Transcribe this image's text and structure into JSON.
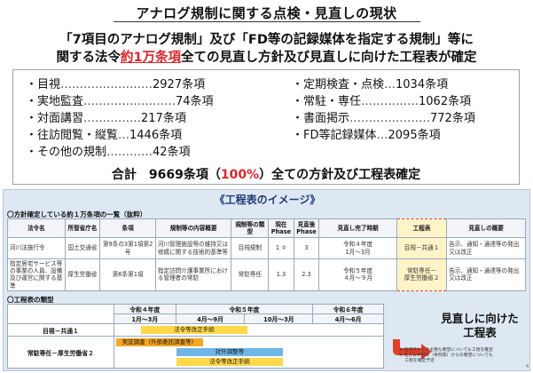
{
  "title": "アナログ規制に関する点検・見直しの現状",
  "lead": {
    "line1": "「7項目のアナログ規制」及び「FD等の記録媒体を指定する規制」等に",
    "line2_prefix": "関する法令",
    "line2_accent": "約1万条項",
    "line2_suffix": "全ての見直し方針及び見直しに向けた工程表が確定"
  },
  "stats": {
    "left": [
      {
        "label": "・目視",
        "dots": "……………………",
        "value": "2927条項"
      },
      {
        "label": "・実地監査",
        "dots": "……………………",
        "value": "74条項"
      },
      {
        "label": "・対面講習",
        "dots": "……………",
        "value": "217条項"
      },
      {
        "label": "・往訪閲覧・縦覧",
        "dots": "…",
        "value": "1446条項"
      },
      {
        "label": "・その他の規制",
        "dots": "…………",
        "value": "42条項"
      }
    ],
    "right": [
      {
        "label": "・定期検査・点検",
        "dots": "…",
        "value": "1034条項"
      },
      {
        "label": "・常駐・専任",
        "dots": "……………",
        "value": "1062条項"
      },
      {
        "label": "・書面掲示",
        "dots": "…………………",
        "value": "772条項"
      },
      {
        "label": "・FD等記録媒体",
        "dots": "…",
        "value": "2095条項"
      }
    ],
    "total_prefix": "合計　9669条項（",
    "total_accent": "100%",
    "total_suffix": "）全ての方針及び工程表確定"
  },
  "image_panel": {
    "title": "《工程表のイメージ》",
    "section1": "〇方針確定している約１万条項の一覧（抜粋）",
    "section2": "〇工程表の類型",
    "table": {
      "headers": [
        "法令名",
        "所管省庁名",
        "条項",
        "規制等の内容概要",
        "規制等の類型",
        "現在Phase",
        "見直後Phase",
        "見直し完了時期",
        "工程表",
        "見直しの概要"
      ],
      "rows": [
        [
          "河川法施行令",
          "国土交通省",
          "第9条の3第1項第2号",
          "河川管理施設等の維持又は修繕に関する技術的基準等",
          "目視規制",
          "1 ②",
          "3",
          "令和４年度\n1月～3月",
          "目視－共通１",
          "告示、通知・通達等の発出又は改正"
        ],
        [
          "指定居宅サービス等の事業の人員、設備及び運営に関する基準",
          "厚生労働省",
          "第6条第1項",
          "指定訪問介護事業所における管理者の常駐",
          "常駐専任",
          "1.3",
          "2.3",
          "令和５年度\n４月～９月",
          "常駐専任－\n厚生労働省２",
          "告示、通知・通達等の発出又は改正"
        ]
      ]
    },
    "schedule": {
      "years": [
        "令和４年度",
        "令和５年度",
        "令和６年度"
      ],
      "periods": [
        "1月～3月",
        "4月～9月",
        "10月～3月",
        "4月～6月"
      ],
      "rows": [
        {
          "label": "目視－共通１",
          "bars": [
            "法令等改正手続"
          ]
        },
        {
          "label": "常駐専任－厚生労働省２",
          "bars": [
            "実証調査（外部委託調査等）",
            "対外調整等",
            "法令等改正手続"
          ]
        }
      ]
    },
    "callout": "見直しに向けた\n工程表",
    "notes": [
      "※ 経済界からの主要な要望についても工程を確定",
      "※ 地方公共団体（条例等）からの要望についても",
      "　 工程を確定予定"
    ],
    "page_number": "4"
  },
  "colors": {
    "accent_red": "#d9262b",
    "panel_bg": "#dde8f3",
    "bar_yellow": "#ffd84a",
    "bar_orange": "#f5a623",
    "bar_blue": "#6fb6e6",
    "arrow_red": "#e0402a"
  }
}
